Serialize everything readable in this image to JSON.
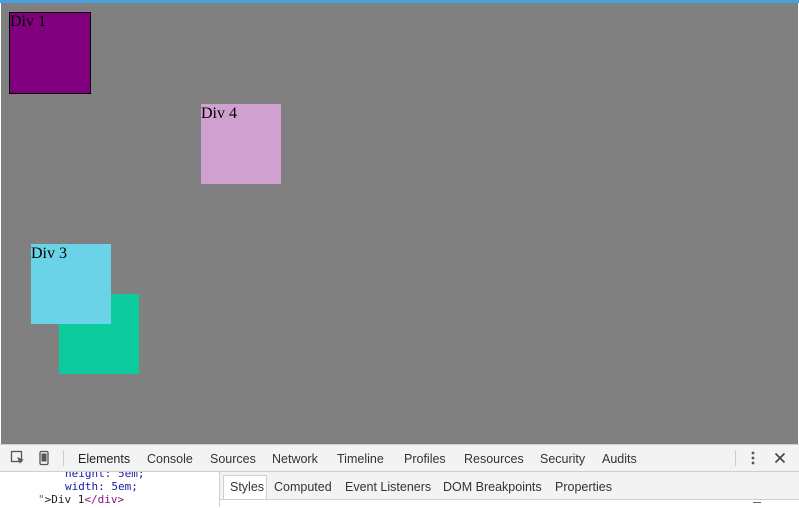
{
  "viewport": {
    "divs": [
      {
        "id": "div1",
        "label": "Div 1",
        "color": "#800080"
      },
      {
        "id": "div4",
        "label": "Div 4",
        "color": "#cfa0d0"
      },
      {
        "id": "div2",
        "label": "",
        "color": "#0ccc9e"
      },
      {
        "id": "div3",
        "label": "Div 3",
        "color": "#6bd3e8"
      }
    ],
    "background": "#808080"
  },
  "devtools": {
    "toolbar": {
      "tabs": [
        "Elements",
        "Console",
        "Sources",
        "Network",
        "Timeline",
        "Profiles",
        "Resources",
        "Security",
        "Audits"
      ],
      "active_tab": "Elements",
      "icons": [
        "inspect-element-icon",
        "device-mode-icon",
        "more-options-icon",
        "close-icon"
      ]
    },
    "dom": {
      "line1": "height: 5em;",
      "line2": "width: 5em;",
      "line3_quote": "\"",
      "line3_text": ">Div 1",
      "line3_close": "</div>"
    },
    "side_tabs": [
      "Styles",
      "Computed",
      "Event Listeners",
      "DOM Breakpoints",
      "Properties"
    ],
    "active_side_tab": "Styles"
  }
}
